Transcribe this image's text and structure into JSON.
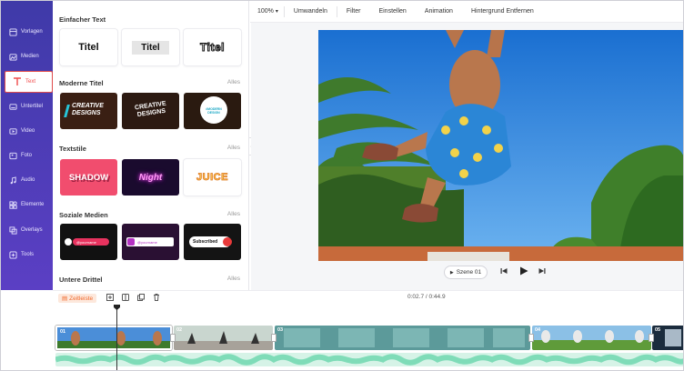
{
  "nav": {
    "items": [
      {
        "label": "Vorlagen",
        "icon": "template-icon"
      },
      {
        "label": "Medien",
        "icon": "media-icon"
      },
      {
        "label": "Text",
        "icon": "text-icon",
        "active": true
      },
      {
        "label": "Untertitel",
        "icon": "subtitle-icon"
      },
      {
        "label": "Video",
        "icon": "video-icon"
      },
      {
        "label": "Foto",
        "icon": "photo-icon"
      },
      {
        "label": "Audio",
        "icon": "audio-icon"
      },
      {
        "label": "Elemente",
        "icon": "elements-icon"
      },
      {
        "label": "Overlays",
        "icon": "overlays-icon"
      },
      {
        "label": "Tools",
        "icon": "tools-icon"
      }
    ]
  },
  "panel": {
    "sections": [
      {
        "title": "Einfacher Text",
        "all": ""
      },
      {
        "title": "Moderne Titel",
        "all": "Alles"
      },
      {
        "title": "Textstile",
        "all": "Alles"
      },
      {
        "title": "Soziale Medien",
        "all": "Alles"
      },
      {
        "title": "Untere Drittel",
        "all": "Alles"
      }
    ],
    "simple_cards": [
      "Titel",
      "Titel",
      "Titel"
    ],
    "modern_cards": [
      "CREATIVE DESIGNS",
      "CREATIVE DESIGNS",
      "#MODERN DESIGN"
    ],
    "style_cards": [
      "SHADOW",
      "Night",
      "JUICE"
    ],
    "social_cards": [
      "@yourname",
      "@yourname",
      "Subscribed"
    ]
  },
  "toolbar": {
    "zoom": "100%",
    "items": [
      "Umwandeln",
      "Filter",
      "Einstellen",
      "Animation",
      "Hintergrund Entfernen"
    ]
  },
  "player": {
    "scene_label": "Szene 01"
  },
  "timeline": {
    "label": "Zeitleiste",
    "time": "0:02.7 / 0:44.9",
    "clips": [
      "01",
      "02",
      "03",
      "04",
      "05"
    ]
  },
  "colors": {
    "nav_bg": "#4b3db8",
    "active": "#f04a4a",
    "accent_orange": "#f06a2e",
    "wave": "#7fdcb8"
  }
}
